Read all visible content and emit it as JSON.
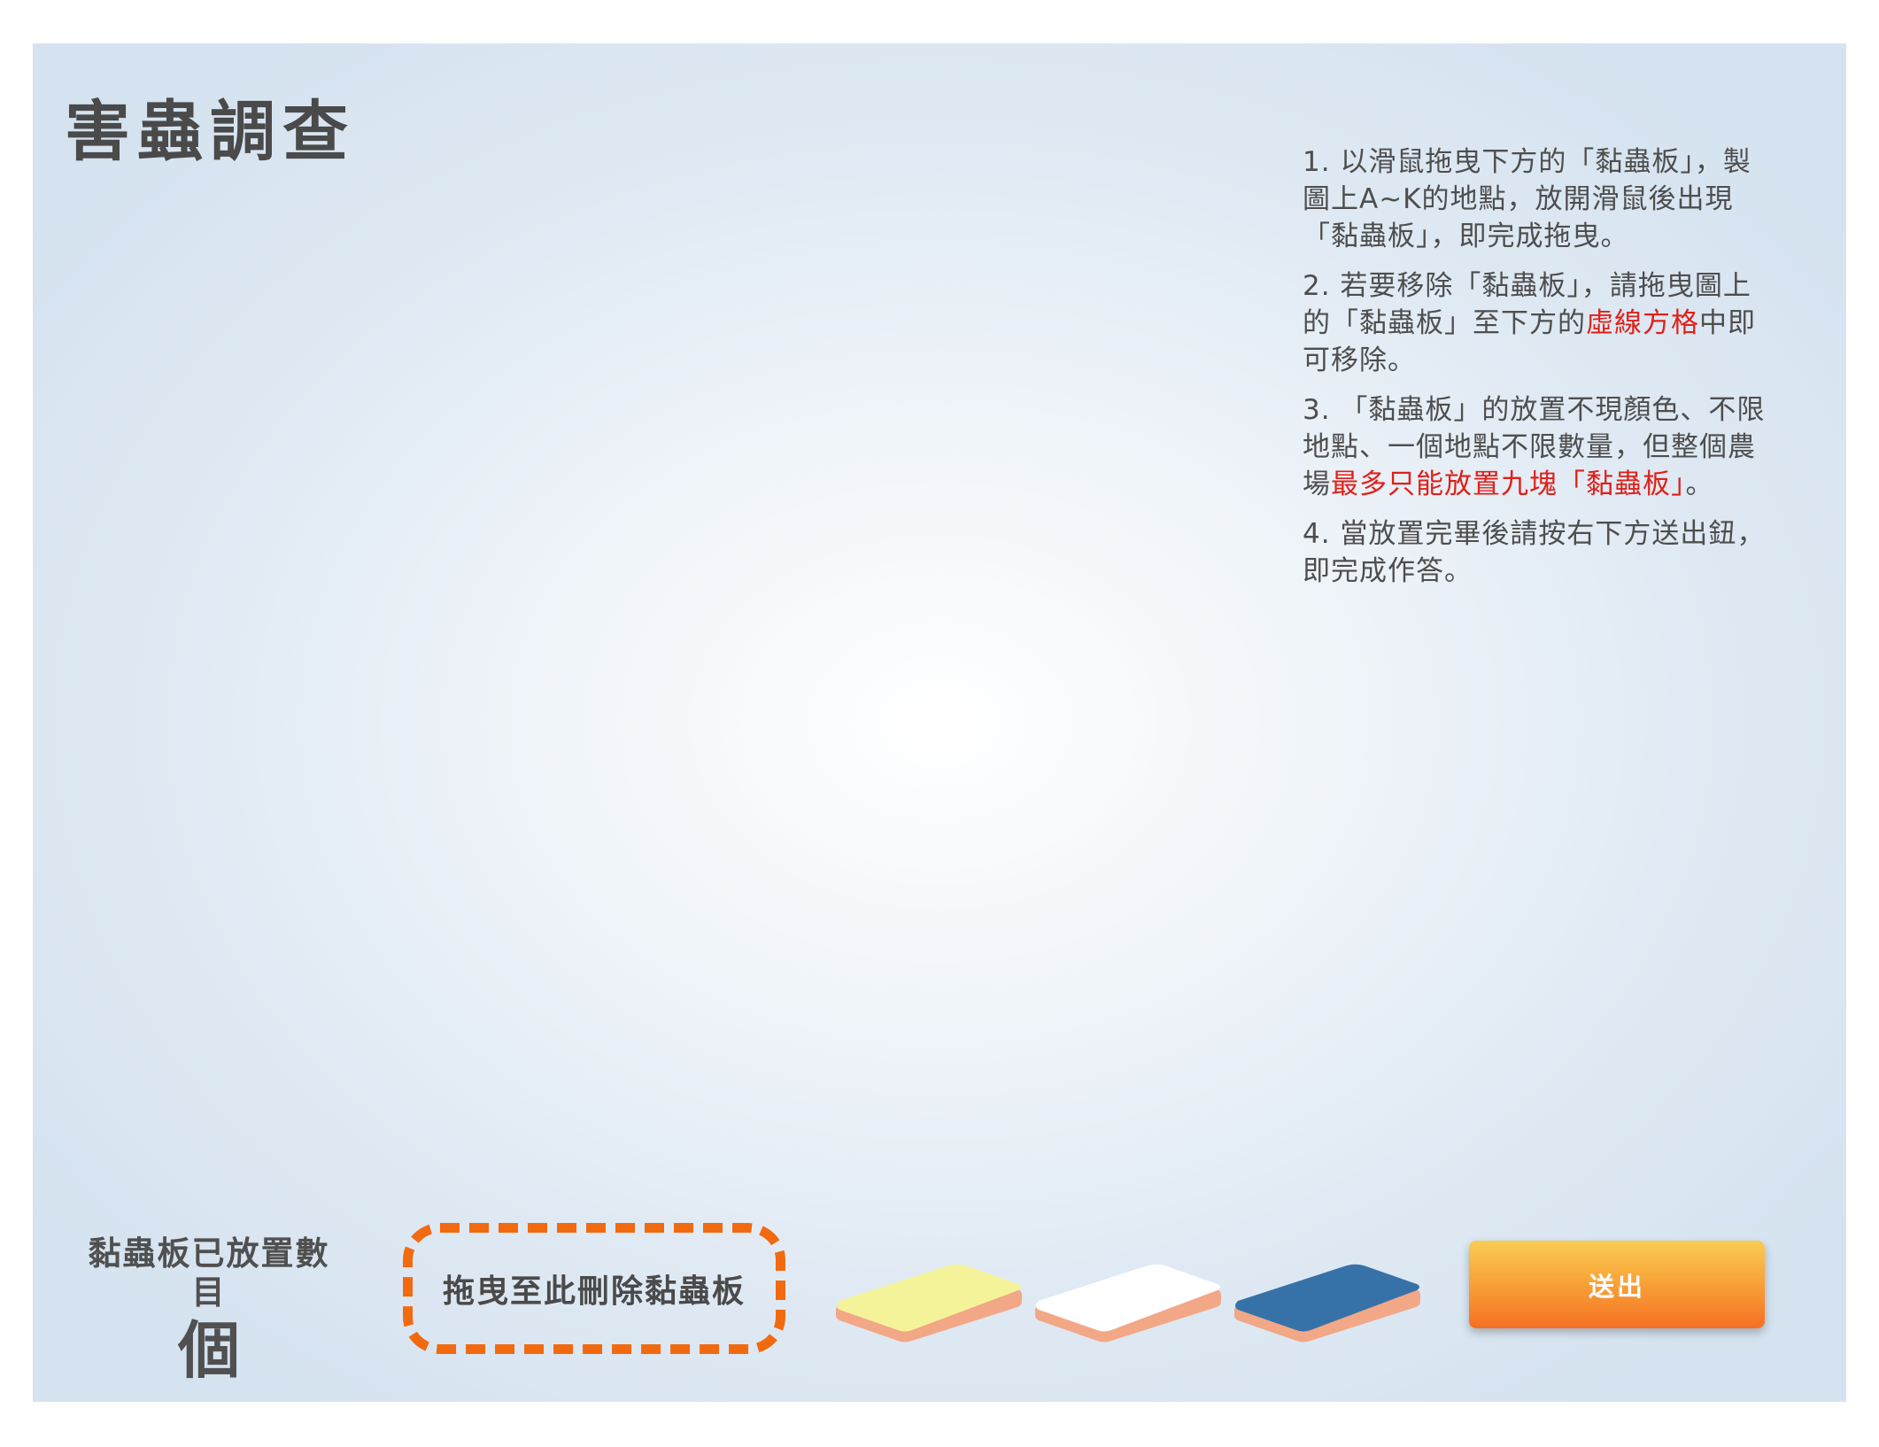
{
  "page": {
    "title": "害蟲調查"
  },
  "instructions": [
    {
      "parts": [
        "1. 以滑鼠拖曳下方的「黏蟲板」，製圖上A~K的地點，放開滑鼠後出現「黏蟲板」，即完成拖曳。"
      ]
    },
    {
      "parts": [
        "2. 若要移除「黏蟲板」，請拖曳圖上的「黏蟲板」至下方的",
        "虛線方格",
        "中即可移除。"
      ]
    },
    {
      "parts": [
        "3. 「黏蟲板」的放置不現顏色、不限地點、一個地點不限數量，但整個農場",
        "最多只能放置九塊「黏蟲板」",
        "。"
      ]
    },
    {
      "parts": [
        "4. 當放置完畢後請按右下方送出鈕，即完成作答。"
      ]
    }
  ],
  "counter": {
    "label": "黏蟲板已放置數目",
    "unit": "個"
  },
  "trash_zone": {
    "label": "拖曳至此刪除黏蟲板"
  },
  "boards": [
    {
      "name": "yellow-sticky-board",
      "color": "#f5f39a"
    },
    {
      "name": "white-sticky-board",
      "color": "#ffffff"
    },
    {
      "name": "blue-sticky-board",
      "color": "#3672a7"
    }
  ],
  "board_edge_color": "#f2a786",
  "submit": {
    "label": "送出"
  },
  "colors": {
    "highlight": "#e0201a",
    "accent": "#f26a10",
    "text": "#4a4a4a"
  }
}
